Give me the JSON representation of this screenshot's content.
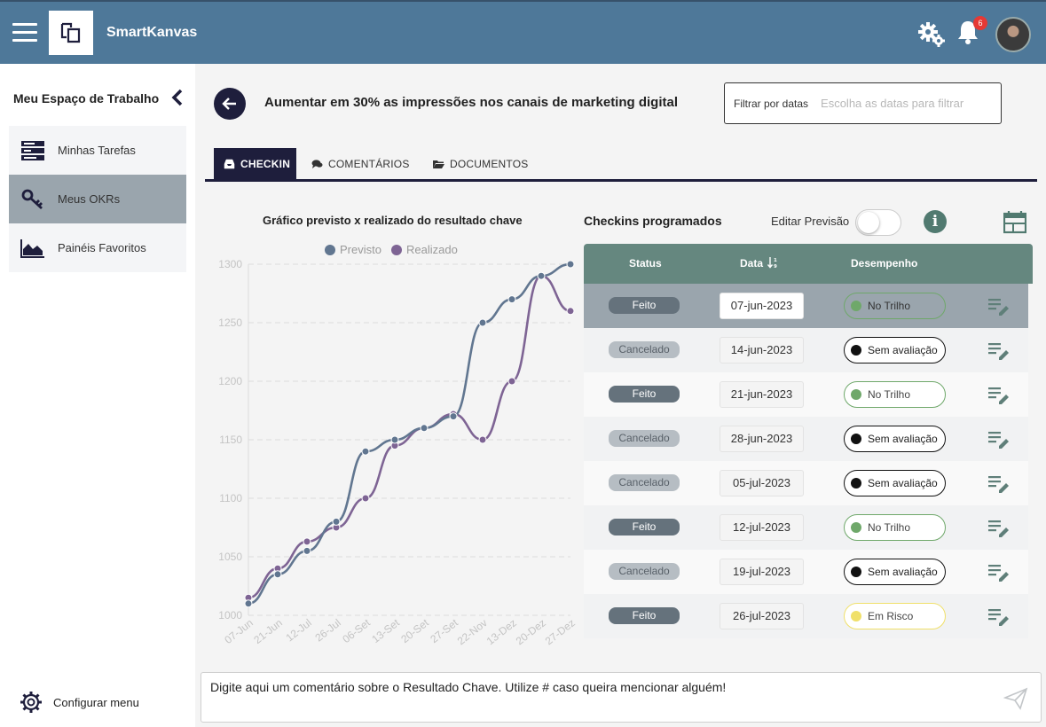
{
  "header": {
    "app_title": "SmartKanvas",
    "notification_count": "6",
    "accent_color": "#4e7899",
    "icons": [
      "menu-icon",
      "logo-icon",
      "settings-icon",
      "bell-icon",
      "avatar"
    ]
  },
  "sidebar": {
    "title": "Meu Espaço de Trabalho",
    "items": [
      {
        "label": "Minhas Tarefas",
        "icon": "tasks-icon",
        "active": false
      },
      {
        "label": "Meus OKRs",
        "icon": "key-icon",
        "active": true
      },
      {
        "label": "Painéis Favoritos",
        "icon": "area-chart-icon",
        "active": false
      }
    ],
    "config_label": "Configurar menu"
  },
  "main": {
    "kr_title": "Aumentar em 30% as impressões nos canais de marketing digital",
    "date_filter": {
      "label": "Filtrar por datas",
      "placeholder": "Escolha as datas para filtrar"
    },
    "tabs": [
      {
        "label": "CHECKIN",
        "icon": "inbox-icon",
        "active": true
      },
      {
        "label": "COMENTÁRIOS",
        "icon": "comments-icon",
        "active": false
      },
      {
        "label": "DOCUMENTOS",
        "icon": "folder-icon",
        "active": false
      }
    ]
  },
  "chart_data": {
    "type": "line",
    "title": "Gráfico previsto x realizado do resultado chave",
    "legend_position": "top",
    "grid": true,
    "categories": [
      "07-Jun",
      "21-Jun",
      "12-Jul",
      "26-Jul",
      "06-Set",
      "13-Set",
      "20-Set",
      "27-Set",
      "22-Nov",
      "13-Dez",
      "20-Dez",
      "27-Dez"
    ],
    "ylim": [
      1000,
      1300
    ],
    "yticks": [
      1000,
      1050,
      1100,
      1150,
      1200,
      1250,
      1300
    ],
    "series": [
      {
        "name": "Previsto",
        "color": "#617690",
        "values": [
          1010,
          1035,
          1055,
          1080,
          1140,
          1150,
          1160,
          1170,
          1250,
          1270,
          1290,
          1300
        ]
      },
      {
        "name": "Realizado",
        "color": "#7e6494",
        "values": [
          1015,
          1040,
          1063,
          1075,
          1100,
          1145,
          1160,
          1172,
          1150,
          1200,
          1290,
          1260
        ]
      }
    ]
  },
  "checkins": {
    "title": "Checkins programados",
    "edit_forecast_label": "Editar Previsão",
    "edit_forecast_on": false,
    "info_symbol": "i",
    "columns": {
      "status": "Status",
      "date": "Data",
      "performance": "Desempenho"
    },
    "rows": [
      {
        "status": "Feito",
        "date": "07-jun-2023",
        "performance": "No Trilho",
        "perf_color": "#6fa86a"
      },
      {
        "status": "Cancelado",
        "date": "14-jun-2023",
        "performance": "Sem avaliação",
        "perf_color": "#111111"
      },
      {
        "status": "Feito",
        "date": "21-jun-2023",
        "performance": "No Trilho",
        "perf_color": "#6fa86a"
      },
      {
        "status": "Cancelado",
        "date": "28-jun-2023",
        "performance": "Sem avaliação",
        "perf_color": "#111111"
      },
      {
        "status": "Cancelado",
        "date": "05-jul-2023",
        "performance": "Sem avaliação",
        "perf_color": "#111111"
      },
      {
        "status": "Feito",
        "date": "12-jul-2023",
        "performance": "No Trilho",
        "perf_color": "#6fa86a"
      },
      {
        "status": "Cancelado",
        "date": "19-jul-2023",
        "performance": "Sem avaliação",
        "perf_color": "#111111"
      },
      {
        "status": "Feito",
        "date": "26-jul-2023",
        "performance": "Em Risco",
        "perf_color": "#f0e06a"
      }
    ]
  },
  "comment": {
    "placeholder": "Digite aqui um comentário sobre o Resultado Chave. Utilize # caso queira mencionar alguém!"
  }
}
